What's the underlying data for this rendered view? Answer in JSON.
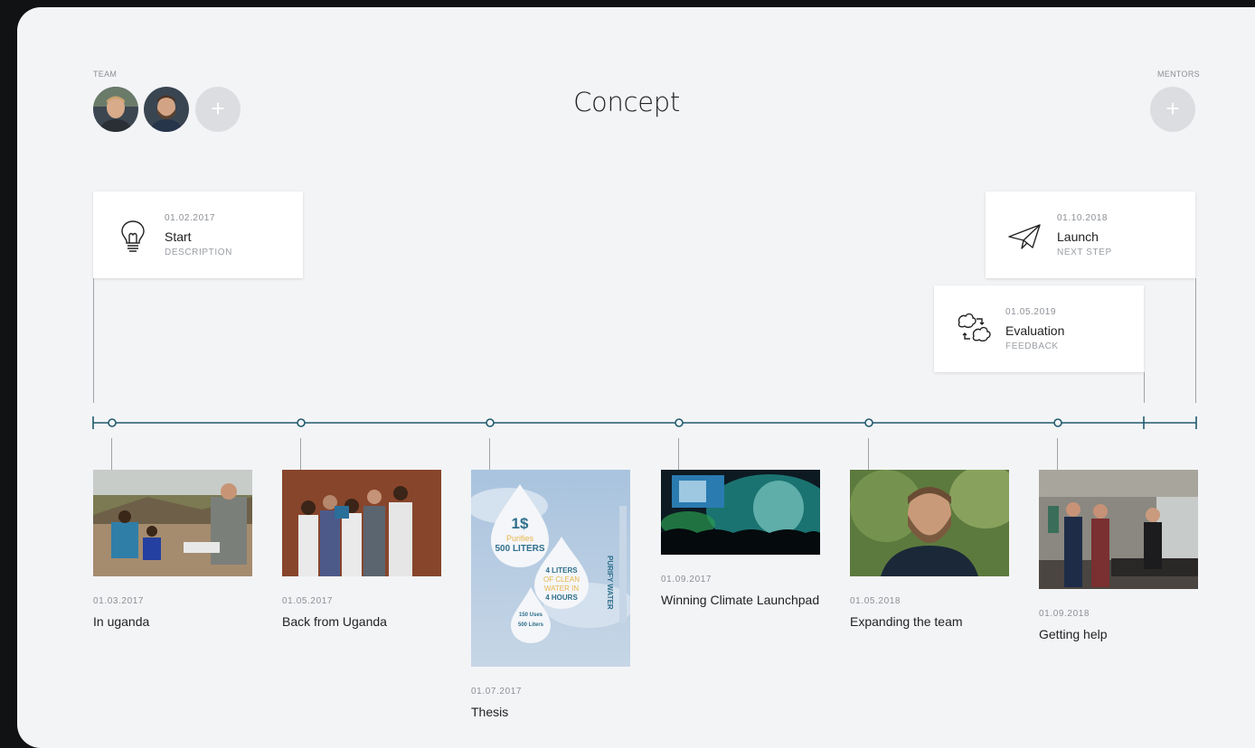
{
  "header": {
    "team_label": "TEAM",
    "mentors_label": "MENTORS",
    "title": "Concept",
    "add_glyph": "+"
  },
  "milestones": [
    {
      "date": "01.02.2017",
      "name": "Start",
      "sub": "DESCRIPTION",
      "icon": "lightbulb-icon"
    },
    {
      "date": "01.10.2018",
      "name": "Launch",
      "sub": "NEXT STEP",
      "icon": "paper-plane-icon"
    },
    {
      "date": "01.05.2019",
      "name": "Evaluation",
      "sub": "FEEDBACK",
      "icon": "refresh-clouds-icon"
    }
  ],
  "events": [
    {
      "date": "01.03.2017",
      "title": "In uganda"
    },
    {
      "date": "01.05.2017",
      "title": "Back from Uganda"
    },
    {
      "date": "01.07.2017",
      "title": "Thesis"
    },
    {
      "date": "01.09.2017",
      "title": "Winning Climate Launchpad"
    },
    {
      "date": "01.05.2018",
      "title": "Expanding the team"
    },
    {
      "date": "01.09.2018",
      "title": "Getting help"
    }
  ],
  "thesis_cover": {
    "price": "1$",
    "purifies": "Purifies",
    "liters": "500 LITERS",
    "drop2_big": "4 LITERS",
    "drop2_a": "OF CLEAN",
    "drop2_b": "WATER IN",
    "drop2_c": "4 HOURS",
    "drop3_a": "150 Uses",
    "drop3_b": "500 Liters",
    "side_text": "PURIFY WATER"
  },
  "colors": {
    "timeline": "#1f5a6e",
    "background": "#f3f4f6",
    "frame": "#111214"
  }
}
